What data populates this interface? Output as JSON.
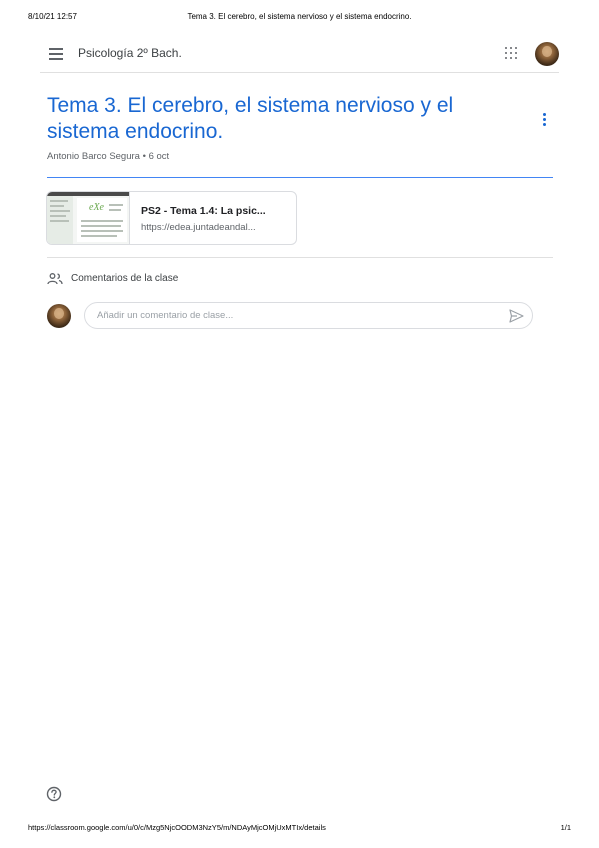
{
  "print_header": {
    "datetime": "8/10/21 12:57",
    "doc_title": "Tema 3. El cerebro, el sistema nervioso y el sistema endocrino."
  },
  "topbar": {
    "menu_icon": "hamburger-menu-icon",
    "class_name": "Psicología 2º Bach.",
    "apps_icon": "google-apps-grid-icon",
    "avatar_icon": "user-avatar"
  },
  "post": {
    "title": "Tema 3. El cerebro, el sistema nervioso y el sistema endocrino.",
    "author": "Antonio Barco Segura",
    "separator": " • ",
    "date": "6 oct",
    "more_icon": "more-vert-icon",
    "accent_color": "#1967d2"
  },
  "attachment": {
    "title": "PS2 - Tema 1.4: La psic...",
    "url": "https://edea.juntadeandal...",
    "thumb_logo": "eXe"
  },
  "comments": {
    "icon": "people-icon",
    "label": "Comentarios de la clase",
    "placeholder": "Añadir un comentario de clase...",
    "send_icon": "send-icon"
  },
  "help_icon": "help-circle-icon",
  "print_footer": {
    "url": "https://classroom.google.com/u/0/c/Mzg5NjcOODM3NzY5/m/NDAyMjcOMjUxMTIx/details",
    "page": "1/1"
  }
}
